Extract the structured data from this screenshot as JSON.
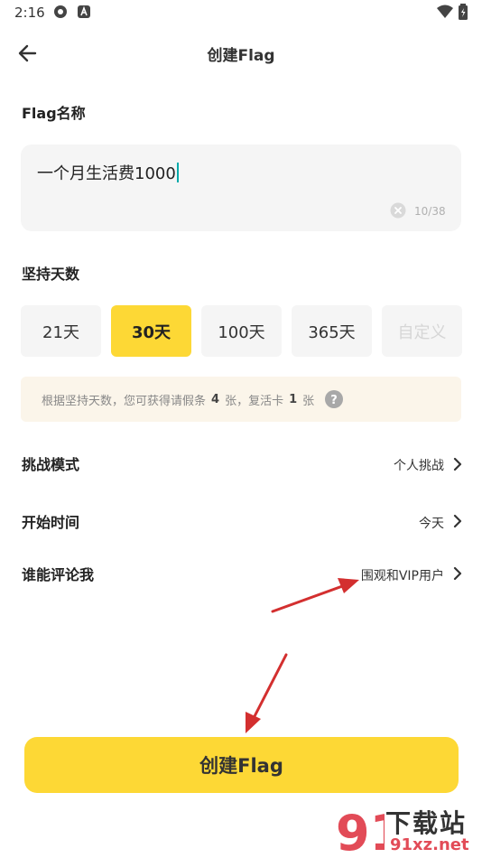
{
  "status_bar": {
    "time": "2:16"
  },
  "header": {
    "title": "创建Flag"
  },
  "flag_name": {
    "label": "Flag名称",
    "value": "一个月生活费1000",
    "counter": "10/38"
  },
  "days": {
    "label": "坚持天数",
    "options": [
      "21天",
      "30天",
      "100天",
      "365天",
      "自定义"
    ],
    "selected": "30天"
  },
  "info": {
    "text1": "根据坚持天数，您可获得请假条",
    "leave_count": "4",
    "text2": "张，复活卡",
    "revive_count": "1",
    "text3": "张"
  },
  "settings": [
    {
      "label": "挑战模式",
      "value": "个人挑战"
    },
    {
      "label": "开始时间",
      "value": "今天"
    },
    {
      "label": "谁能评论我",
      "value": "围观和VIP用户"
    }
  ],
  "create_button": {
    "label": "创建Flag"
  },
  "watermark": {
    "brand": "下载站",
    "url": "91xz.net",
    "logo_text": "91"
  },
  "colors": {
    "accent": "#fdd835",
    "arrow": "#d32f2f",
    "info_bg": "#fbf5ea"
  }
}
